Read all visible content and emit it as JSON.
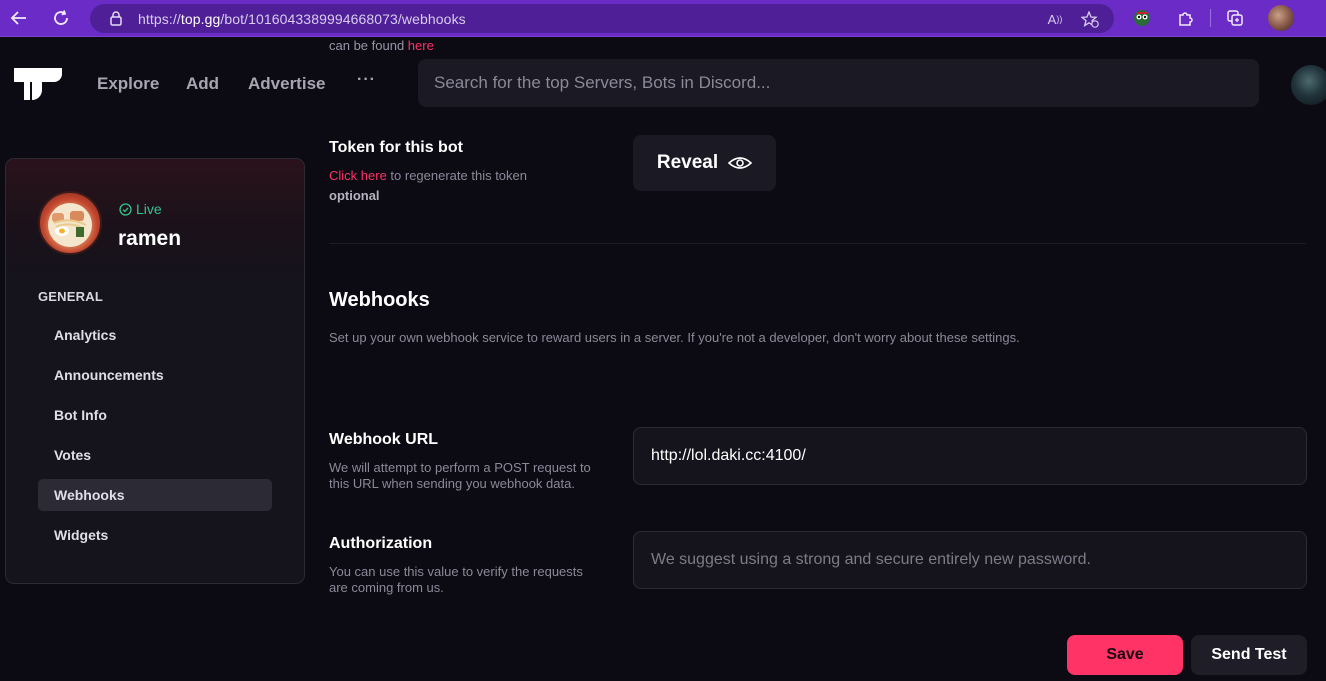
{
  "browser": {
    "url_prefix": "https://",
    "url_host": "top.gg",
    "url_path": "/bot/1016043389994668073/webhooks",
    "icons": [
      "back-icon",
      "refresh-icon",
      "lock-icon",
      "read-aloud-icon",
      "favorite-icon",
      "extension-icon",
      "puzzle-icon",
      "collections-icon",
      "profile-icon"
    ]
  },
  "header": {
    "cut_text": "can be found ",
    "cut_link": "here",
    "nav": [
      "Explore",
      "Add",
      "Advertise"
    ],
    "more": "···",
    "search_placeholder": "Search for the top Servers, Bots in Discord..."
  },
  "sidebar": {
    "bot_status": "Live",
    "bot_name": "ramen",
    "section": "GENERAL",
    "items": [
      "Analytics",
      "Announcements",
      "Bot Info",
      "Votes",
      "Webhooks",
      "Widgets"
    ],
    "active_item": "Webhooks"
  },
  "token": {
    "title": "Token for this bot",
    "link": "Click here",
    "desc": " to regenerate this token",
    "optional": "optional",
    "reveal_label": "Reveal"
  },
  "webhooks": {
    "title": "Webhooks",
    "desc": "Set up your own webhook service to reward users in a server. If you're not a developer, don't worry about these settings."
  },
  "webhook_url": {
    "title": "Webhook URL",
    "desc_line1": "We will attempt to perform a POST request to",
    "desc_line2": "this URL when sending you webhook data.",
    "value": "http://lol.daki.cc:4100/"
  },
  "authorization": {
    "title": "Authorization",
    "desc_line1": "You can use this value to verify the requests",
    "desc_line2": "are coming from us.",
    "placeholder": "We suggest using a strong and secure entirely new password."
  },
  "actions": {
    "save": "Save",
    "send_test": "Send Test"
  },
  "colors": {
    "accent": "#ff3366",
    "browser": "#6b2bc7",
    "live": "#31c48d",
    "background": "#0c0a13"
  }
}
